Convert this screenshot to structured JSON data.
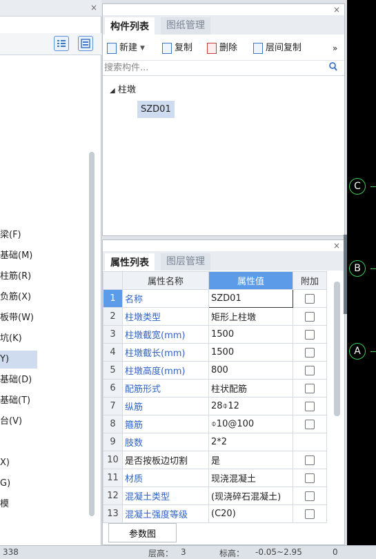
{
  "left_panel": {
    "close_label": "×",
    "items": [
      {
        "label": "梁(F)"
      },
      {
        "label": "基础(M)"
      },
      {
        "label": "柱筋(R)"
      },
      {
        "label": "负筋(X)"
      },
      {
        "label": "板带(W)"
      },
      {
        "label": "坑(K)"
      },
      {
        "label": "Y)",
        "selected": true
      },
      {
        "label": "基础(D)"
      },
      {
        "label": "基础(T)"
      },
      {
        "label": "台(V)"
      },
      {
        "label": ""
      },
      {
        "label": "X)"
      },
      {
        "label": "G)"
      },
      {
        "label": "模"
      }
    ]
  },
  "component_panel": {
    "close_label": "×",
    "tabs": [
      "构件列表",
      "图纸管理"
    ],
    "toolbar": {
      "new_label": "新建",
      "copy_label": "复制",
      "delete_label": "删除",
      "floor_copy_label": "层间复制",
      "more_label": "»"
    },
    "search_placeholder": "搜索构件...",
    "tree": {
      "root_label": "柱墩",
      "child_label": "SZD01"
    }
  },
  "property_panel": {
    "close_label": "×",
    "tabs": [
      "属性列表",
      "图层管理"
    ],
    "headers": {
      "name": "属性名称",
      "value": "属性值",
      "extra": "附加"
    },
    "rows": [
      {
        "num": "1",
        "name": "名称",
        "value": "SZD01",
        "blue": true,
        "checkbox": true
      },
      {
        "num": "2",
        "name": "柱墩类型",
        "value": "矩形上柱墩",
        "blue": true,
        "checkbox": true
      },
      {
        "num": "3",
        "name": "柱墩截宽(mm)",
        "value": "1500",
        "blue": true,
        "checkbox": true
      },
      {
        "num": "4",
        "name": "柱墩截长(mm)",
        "value": "1500",
        "blue": true,
        "checkbox": true
      },
      {
        "num": "5",
        "name": "柱墩高度(mm)",
        "value": "800",
        "blue": true,
        "checkbox": true
      },
      {
        "num": "6",
        "name": "配筋形式",
        "value": "柱状配筋",
        "blue": true,
        "checkbox": true
      },
      {
        "num": "7",
        "name": "纵筋",
        "value": "28⌽12",
        "blue": true,
        "checkbox": true
      },
      {
        "num": "8",
        "name": "箍筋",
        "value": "⌽10@100",
        "blue": true,
        "checkbox": true
      },
      {
        "num": "9",
        "name": "肢数",
        "value": "2*2",
        "blue": true,
        "checkbox": false
      },
      {
        "num": "10",
        "name": "是否按板边切割",
        "value": "是",
        "blue": false,
        "checkbox": true
      },
      {
        "num": "11",
        "name": "材质",
        "value": "现浇混凝土",
        "blue": true,
        "checkbox": true
      },
      {
        "num": "12",
        "name": "混凝土类型",
        "value": "(现浇碎石混凝土)",
        "blue": true,
        "checkbox": true
      },
      {
        "num": "13",
        "name": "混凝土强度等级",
        "value": "(C20)",
        "blue": true,
        "checkbox": true
      }
    ],
    "param_button_label": "参数图"
  },
  "canvas": {
    "axis_labels": [
      "C",
      "B",
      "A"
    ],
    "axis_color": "#3ccf5a"
  },
  "statusbar": {
    "left_value": "338",
    "floor_height_label": "层高：",
    "floor_height_value": "3",
    "elevation_label": "标高：",
    "elevation_value": "-0.05~2.95",
    "right_value": "0"
  }
}
